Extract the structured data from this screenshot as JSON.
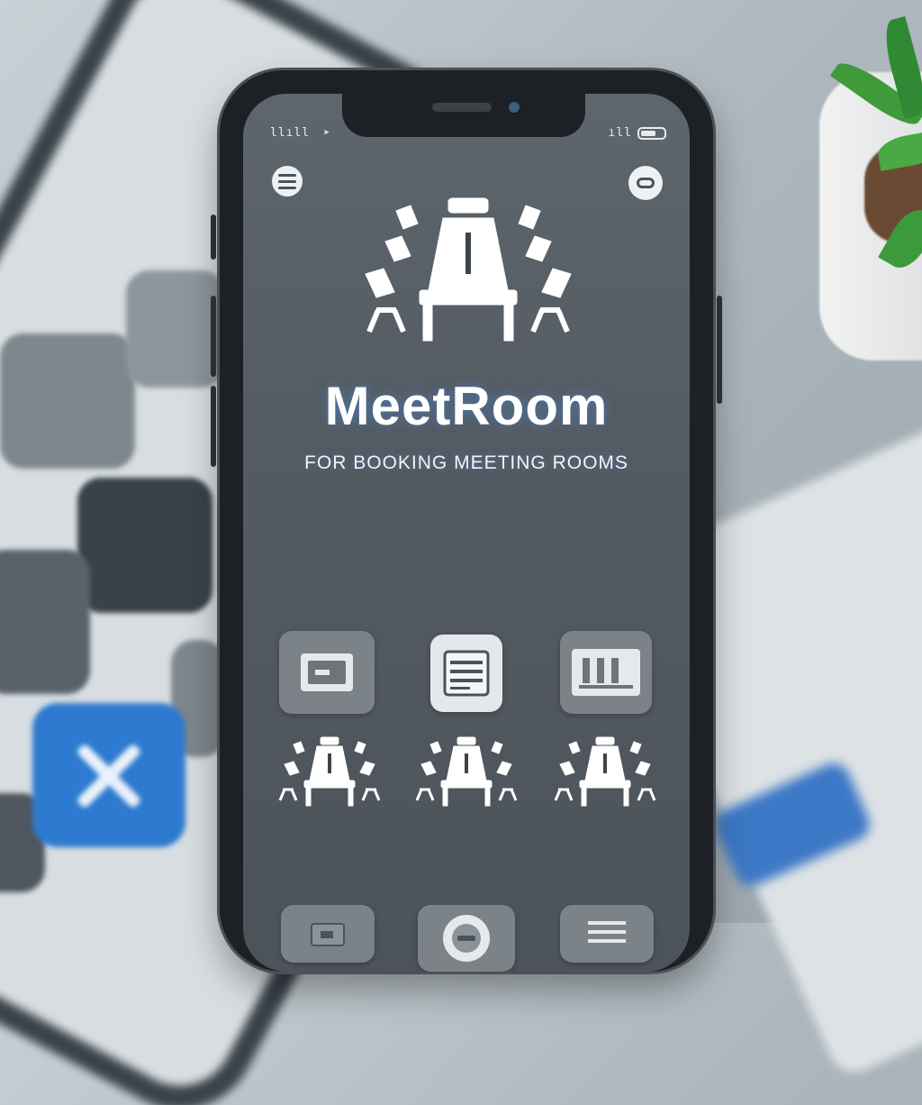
{
  "app": {
    "title": "MeetRoom",
    "subtitle": "FOR BOOKING MEETING ROOMS"
  },
  "status_bar": {
    "left_text": "llıll",
    "right_text": "ıll"
  },
  "icons": {
    "menu": "menu-icon",
    "profile": "profile-icon",
    "hero": "conference-table-icon",
    "wifi": "wifi-icon",
    "battery": "battery-icon",
    "quick_actions": [
      "calendar-icon",
      "list-icon",
      "schedule-icon"
    ],
    "rooms": [
      "conference-room-icon",
      "conference-room-icon",
      "conference-room-icon"
    ],
    "bottom_actions": [
      "folder-icon",
      "search-icon",
      "menu-list-icon"
    ]
  },
  "colors": {
    "screen_bg": "#545b62",
    "accent_glow": "#4682c8",
    "text": "#ffffff"
  }
}
